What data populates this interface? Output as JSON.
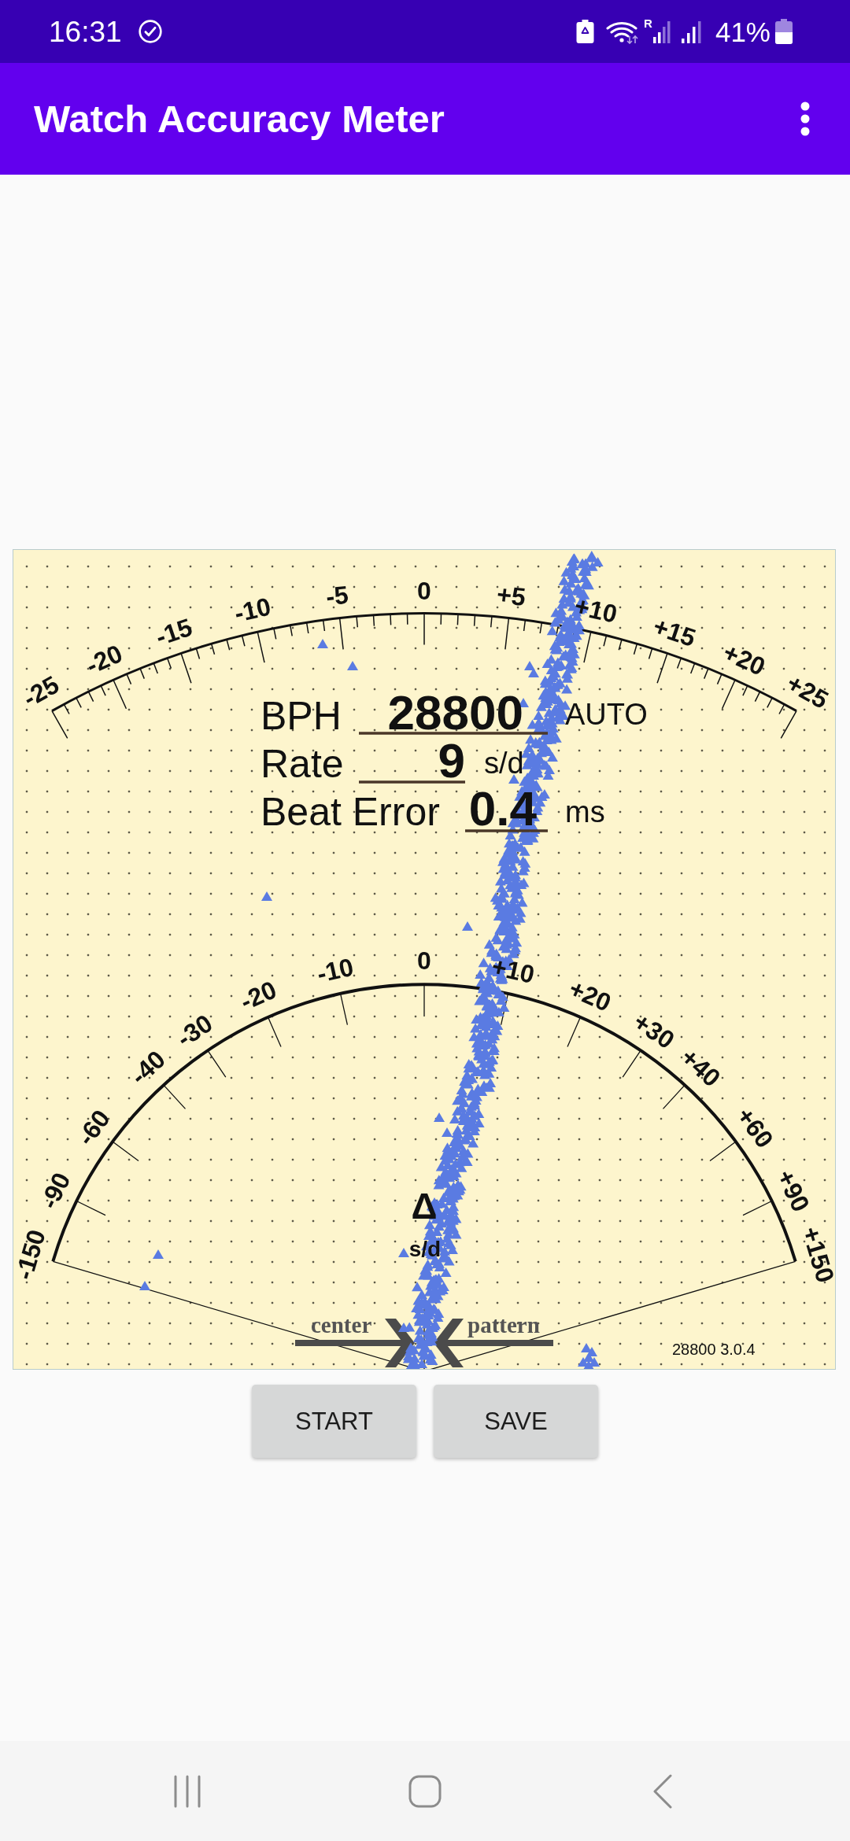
{
  "status_bar": {
    "time": "16:31",
    "roaming": "R",
    "battery": "41%"
  },
  "app_bar": {
    "title": "Watch Accuracy Meter"
  },
  "meter": {
    "rate_scale": {
      "labels": [
        "-25",
        "-20",
        "-15",
        "-10",
        "-5",
        "0",
        "+5",
        "+10",
        "+15",
        "+20",
        "+25"
      ]
    },
    "readouts": [
      {
        "label": "BPH",
        "value": "28800",
        "suffix": "AUTO"
      },
      {
        "label": "Rate",
        "value": "9",
        "suffix": "s/d"
      },
      {
        "label": "Beat Error",
        "value": "0.4",
        "suffix": "ms"
      }
    ],
    "delta_scale": {
      "labels": [
        "-150",
        "-90",
        "-60",
        "-40",
        "-30",
        "-20",
        "-10",
        "0",
        "+10",
        "+20",
        "+30",
        "+40",
        "+60",
        "+90",
        "+150"
      ],
      "symbol": "Δ",
      "unit": "s/d"
    },
    "arrow_labels": [
      "center",
      "pattern"
    ],
    "version": "28800 3.0.4"
  },
  "buttons": [
    {
      "label": "START"
    },
    {
      "label": "SAVE"
    }
  ]
}
